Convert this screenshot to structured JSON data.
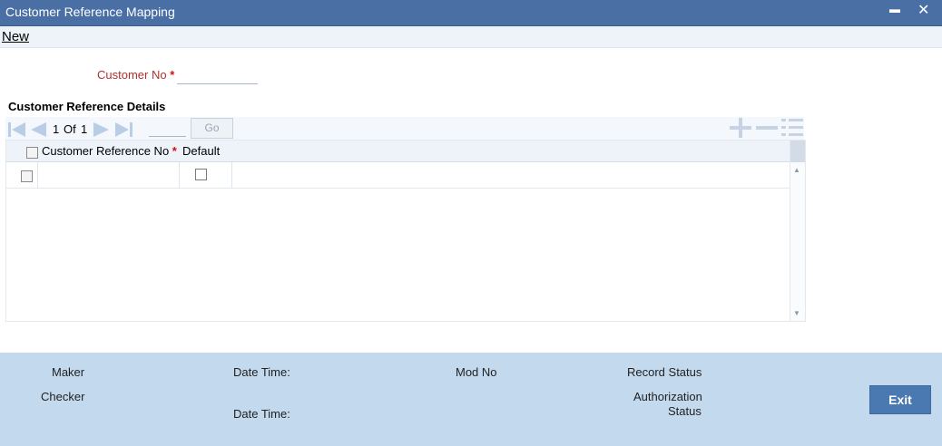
{
  "window": {
    "title": "Customer Reference Mapping",
    "minimize_glyph": "▬",
    "close_glyph": "✕"
  },
  "menu": {
    "new_label": "New"
  },
  "form": {
    "customer_no_label": "Customer No",
    "required_mark": "*",
    "customer_no_value": ""
  },
  "section": {
    "title": "Customer Reference Details"
  },
  "grid_toolbar": {
    "page_current": "1",
    "page_of": "Of",
    "page_total": "1",
    "page_input_value": "",
    "go_label": "Go",
    "icons": [
      "first-page-icon",
      "prev-page-icon",
      "next-page-icon",
      "last-page-icon",
      "add-row-icon",
      "delete-row-icon",
      "single-view-icon"
    ]
  },
  "grid": {
    "columns": [
      {
        "label": "Customer Reference No",
        "required": "*"
      },
      {
        "label": "Default"
      }
    ],
    "rows": [
      {
        "customer_reference_no": "",
        "default": false
      }
    ]
  },
  "footer": {
    "maker_label": "Maker",
    "checker_label": "Checker",
    "date_time_label_1": "Date Time:",
    "date_time_label_2": "Date Time:",
    "mod_no_label": "Mod No",
    "record_status_label": "Record Status",
    "authorization_label_line1": "Authorization",
    "authorization_label_line2": "Status",
    "exit_label": "Exit"
  },
  "colors": {
    "titlebar": "#4a6fa5",
    "footer": "#c3d9ee",
    "exit_button": "#4a78b0",
    "required": "#d01010"
  }
}
